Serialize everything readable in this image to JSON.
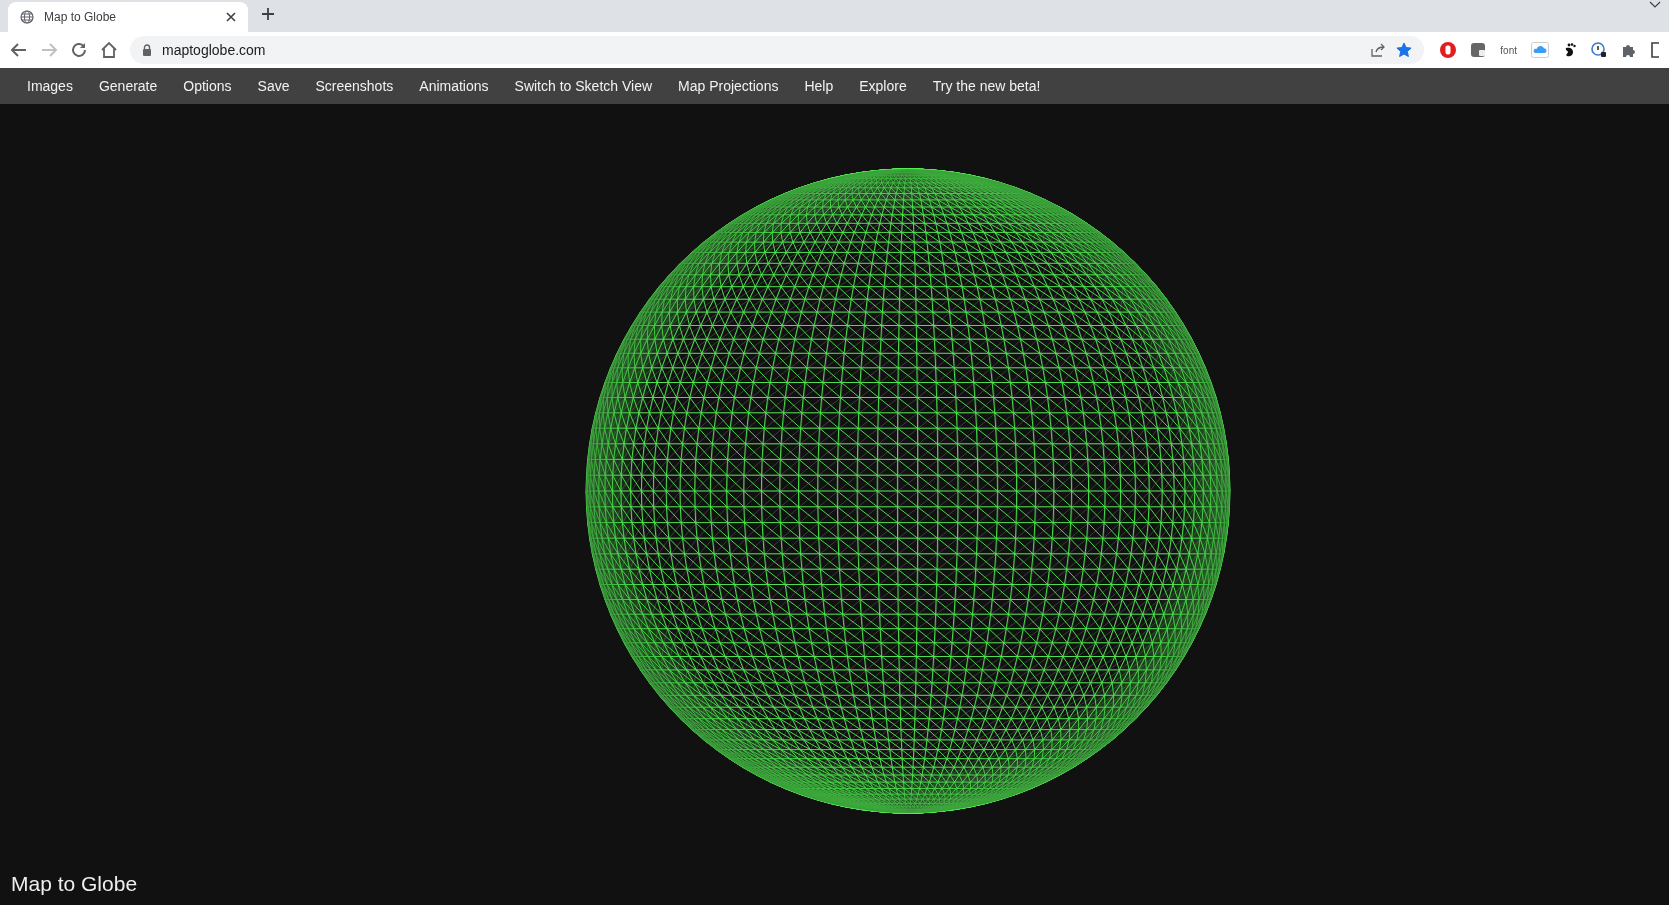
{
  "browser": {
    "tabs": [
      {
        "title": "Map to Globe",
        "selected": true
      }
    ],
    "address": "maptoglobe.com",
    "forward_disabled": true,
    "bookmarked": true,
    "extension_label": "font"
  },
  "menu": [
    "Images",
    "Generate",
    "Options",
    "Save",
    "Screenshots",
    "Animations",
    "Switch to Sketch View",
    "Map Projections",
    "Help",
    "Explore",
    "Try the new beta!"
  ],
  "viewer": {
    "title": "Map to Globe"
  }
}
